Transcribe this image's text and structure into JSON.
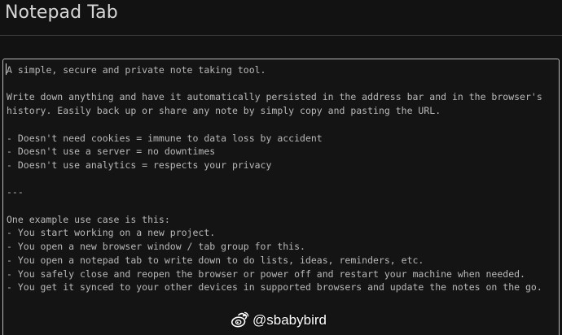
{
  "app": {
    "title": "Notepad Tab"
  },
  "editor": {
    "content": "A simple, secure and private note taking tool.\n\nWrite down anything and have it automatically persisted in the address bar and in the browser's history. Easily back up or share any note by simply copy and pasting the URL.\n\n- Doesn't need cookies = immune to data loss by accident\n- Doesn't use a server = no downtimes\n- Doesn't use analytics = respects your privacy\n\n---\n\nOne example use case is this:\n- You start working on a new project.\n- You open a new browser window / tab group for this.\n- You open a notepad tab to write down to do lists, ideas, reminders, etc.\n- You safely close and reopen the browser or power off and restart your machine when needed.\n- You get it synced to your other devices in supported browsers and update the notes on the go."
  },
  "watermark": {
    "icon": "weibo-logo",
    "text": "@sbabybird"
  },
  "colors": {
    "background": "#121212",
    "text": "#b9b9b9",
    "title": "#d6d6d6",
    "editor_border": "#b8b8b8"
  }
}
